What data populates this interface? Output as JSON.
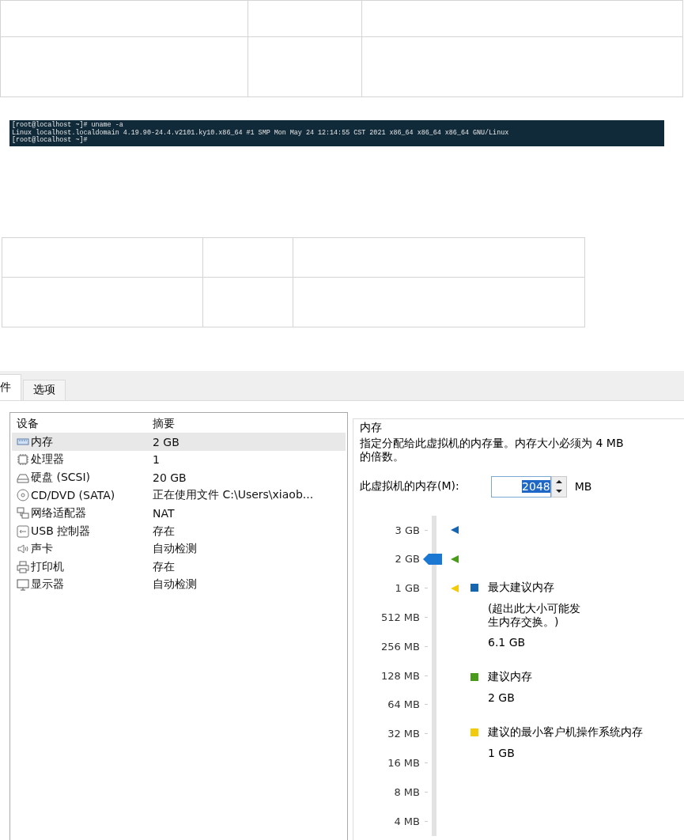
{
  "table_top": {
    "rows": [
      [
        "",
        "",
        ""
      ],
      [
        "",
        "",
        ""
      ]
    ]
  },
  "terminal": {
    "lines": [
      "[root@localhost ~]# uname -a",
      "Linux localhost.localdomain 4.19.90-24.4.v2101.ky10.x86_64 #1 SMP Mon May 24 12:14:55 CST 2021 x86_64 x86_64 x86_64 GNU/Linux",
      "[root@localhost ~]#"
    ]
  },
  "table_middle": {
    "rows": [
      [
        "",
        "",
        ""
      ],
      [
        "",
        "",
        ""
      ]
    ]
  },
  "tabs": [
    {
      "label": "件",
      "selected": true
    },
    {
      "label": "选项",
      "selected": false
    }
  ],
  "devices": {
    "columns": [
      "设备",
      "摘要"
    ],
    "rows": [
      {
        "kind": "memory",
        "name": "内存",
        "summary": "2 GB",
        "selected": true
      },
      {
        "kind": "cpu",
        "name": "处理器",
        "summary": "1",
        "selected": false
      },
      {
        "kind": "disk",
        "name": "硬盘 (SCSI)",
        "summary": "20 GB",
        "selected": false
      },
      {
        "kind": "cd",
        "name": "CD/DVD (SATA)",
        "summary": "正在使用文件 C:\\Users\\xiaob...",
        "selected": false
      },
      {
        "kind": "network",
        "name": "网络适配器",
        "summary": "NAT",
        "selected": false
      },
      {
        "kind": "usb",
        "name": "USB 控制器",
        "summary": "存在",
        "selected": false
      },
      {
        "kind": "sound",
        "name": "声卡",
        "summary": "自动检测",
        "selected": false
      },
      {
        "kind": "printer",
        "name": "打印机",
        "summary": "存在",
        "selected": false
      },
      {
        "kind": "display",
        "name": "显示器",
        "summary": "自动检测",
        "selected": false
      }
    ]
  },
  "memory": {
    "title": "内存",
    "description": "指定分配给此虚拟机的内存量。内存大小必须为 4 MB 的倍数。",
    "field_label": "此虚拟机的内存(M):",
    "value": "2048",
    "unit": "MB",
    "slider": {
      "level": 0.9,
      "ticks": [
        {
          "label": "3 GB",
          "color": "#1565b0"
        },
        {
          "label": "2 GB",
          "color": "#4a9a1c"
        },
        {
          "label": "1 GB",
          "color": "#f2cc0c"
        },
        {
          "label": "512 MB"
        },
        {
          "label": "256 MB"
        },
        {
          "label": "128 MB"
        },
        {
          "label": "64 MB"
        },
        {
          "label": "32 MB"
        },
        {
          "label": "16 MB"
        },
        {
          "label": "8 MB"
        },
        {
          "label": "4 MB"
        }
      ]
    },
    "legend": [
      {
        "color": "#1565b0",
        "title": "最大建议内存",
        "note": "(超出此大小可能发生内存交换。)",
        "value": "6.1 GB"
      },
      {
        "color": "#4a9a1c",
        "title": "建议内存",
        "value": "2 GB"
      },
      {
        "color": "#f2cc0c",
        "title": "建议的最小客户机操作系统内存",
        "value": "1 GB"
      }
    ]
  }
}
